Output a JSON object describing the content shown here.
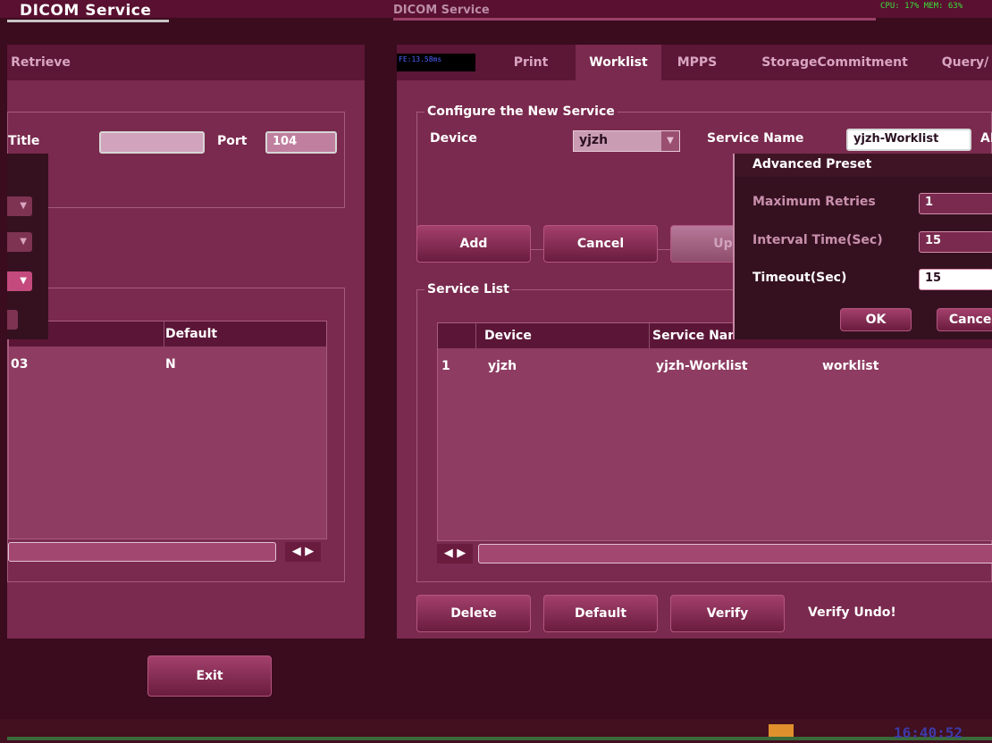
{
  "window": {
    "title_left": "DICOM Service",
    "title_right": "DICOM Service",
    "cpu_mem": "CPU: 17%  MEM: 63%",
    "fe_label": "FE:13.58ms"
  },
  "left_pane": {
    "tab_label": "Retrieve",
    "title_label": "Title",
    "title_value": "",
    "port_label": "Port",
    "port_value": "104",
    "table": {
      "headers": [
        "Default"
      ],
      "row": {
        "id": "03",
        "default": "N"
      }
    },
    "exit_label": "Exit"
  },
  "right_pane": {
    "tabs": [
      "Print",
      "Worklist",
      "MPPS",
      "StorageCommitment",
      "Query/"
    ],
    "active_tab": "Worklist",
    "configure_legend": "Configure the New Service",
    "device_label": "Device",
    "device_value": "yjzh",
    "service_name_label": "Service Name",
    "service_name_value": "yjzh-Worklist",
    "ae_label": "AE",
    "buttons": {
      "add": "Add",
      "cancel": "Cancel",
      "update": "Upd"
    },
    "service_list_legend": "Service List",
    "table": {
      "headers": [
        "Device",
        "Service Nam"
      ],
      "rows": [
        {
          "no": "1",
          "device": "yjzh",
          "service": "yjzh-Worklist",
          "type": "worklist"
        }
      ]
    },
    "bottom_buttons": {
      "delete": "Delete",
      "default": "Default",
      "verify": "Verify"
    },
    "verify_status": "Verify Undo!"
  },
  "popup": {
    "title": "Advanced Preset",
    "max_retries_label": "Maximum Retries",
    "max_retries_value": "1",
    "interval_label": "Interval Time(Sec)",
    "interval_value": "15",
    "timeout_label": "Timeout(Sec)",
    "timeout_value": "15",
    "ok_label": "OK",
    "cancel_label": "Cancel"
  },
  "taskbar": {
    "clock": "16:40:52"
  }
}
